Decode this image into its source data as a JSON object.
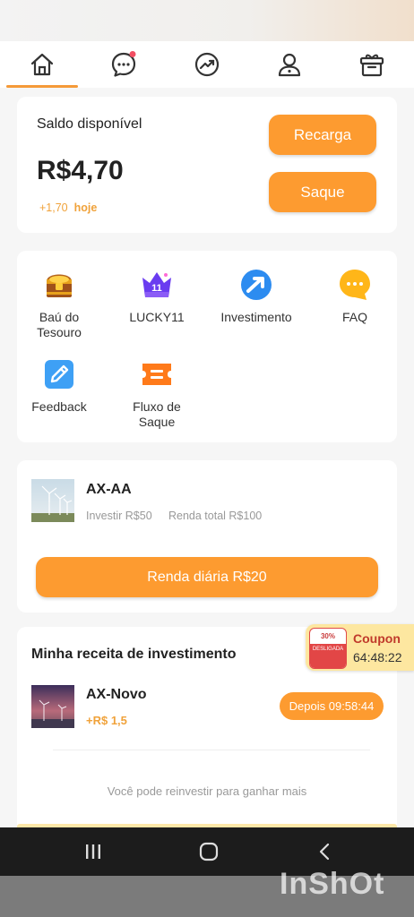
{
  "nav": {
    "tabs": [
      {
        "name": "home",
        "active": true
      },
      {
        "name": "messages",
        "badge": true
      },
      {
        "name": "trends"
      },
      {
        "name": "profile"
      },
      {
        "name": "gifts"
      }
    ]
  },
  "balance": {
    "label": "Saldo disponível",
    "amount": "R$4,70",
    "change": "+1,70",
    "change_suffix": "hoje",
    "recharge_label": "Recarga",
    "withdraw_label": "Saque"
  },
  "menu": {
    "items": [
      {
        "label": "Baú do\nTesouro",
        "icon": "treasure-chest-icon"
      },
      {
        "label": "LUCKY11",
        "icon": "lucky11-crown-icon"
      },
      {
        "label": "Investimento",
        "icon": "investment-arrow-icon"
      },
      {
        "label": "FAQ",
        "icon": "chat-bubble-icon"
      },
      {
        "label": "Feedback",
        "icon": "pencil-icon"
      },
      {
        "label": "Fluxo de\nSaque",
        "icon": "ticket-icon"
      }
    ]
  },
  "product": {
    "name": "AX-AA",
    "invest": "Investir R$50",
    "total": "Renda total R$100",
    "daily_button": "Renda diária R$20"
  },
  "income": {
    "title": "Minha receita de investimento",
    "item_name": "AX-Novo",
    "item_gain": "+R$ 1,5",
    "item_timer": "Depois 09:58:44",
    "footer_note": "Você pode reinvestir para ganhar mais"
  },
  "coupon": {
    "badge_top": "30%",
    "badge_bottom": "DESLIGADA",
    "title": "Coupon",
    "countdown": "64:48:22"
  },
  "watermark": "InShOt",
  "colors": {
    "accent": "#fd9b30",
    "gain": "#f0a23a",
    "system_bar": "#1c1c1c"
  }
}
